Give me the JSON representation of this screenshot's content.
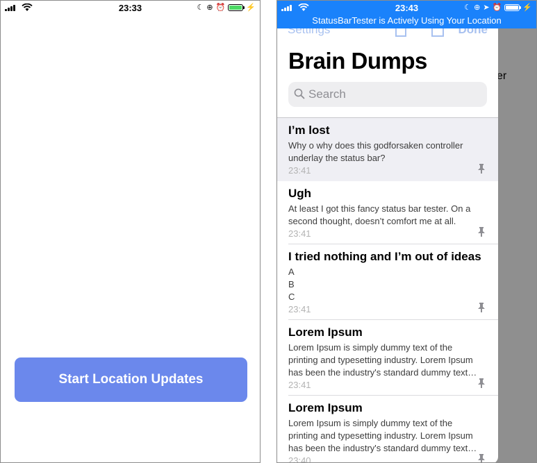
{
  "left_phone": {
    "status": {
      "time": "23:33"
    },
    "start_button_label": "Start Location Updates"
  },
  "right_phone": {
    "status": {
      "time": "23:43"
    },
    "location_banner": "StatusBarTester is Actively Using Your Location",
    "behind_text_fragment": "er",
    "nav": {
      "settings_label": "Settings",
      "done_label": "Done"
    },
    "title": "Brain Dumps",
    "search_placeholder": "Search",
    "notes": [
      {
        "title": "I’m lost",
        "body": "Why o why does this godforsaken controller\nunderlay the status bar?",
        "time": "23:41"
      },
      {
        "title": "Ugh",
        "body": "At least I got this fancy status bar tester. On a\nsecond thought, doesn’t comfort me at all.",
        "time": "23:41"
      },
      {
        "title": "I tried nothing and I’m out of ideas",
        "body": "A\nB\nC",
        "time": "23:41"
      },
      {
        "title": "Lorem Ipsum",
        "body": "Lorem Ipsum is simply dummy text of the\nprinting and typesetting industry. Lorem Ipsum\nhas been the industry's standard dummy text…",
        "time": "23:41"
      },
      {
        "title": "Lorem Ipsum",
        "body": "Lorem Ipsum is simply dummy text of the\nprinting and typesetting industry. Lorem Ipsum\nhas been the industry's standard dummy text…",
        "time": "23:40"
      }
    ]
  },
  "colors": {
    "accent_blue": "#1a82fb",
    "button_blue": "#6b88ec",
    "battery_green": "#4cd964",
    "selected_row": "#efeff4"
  },
  "icons": [
    "signal-icon",
    "wifi-icon",
    "moon-icon",
    "rotation-lock-icon",
    "alarm-icon",
    "location-arrow-icon",
    "battery-icon",
    "charging-icon",
    "trash-icon",
    "compose-icon",
    "search-icon",
    "pin-icon"
  ]
}
